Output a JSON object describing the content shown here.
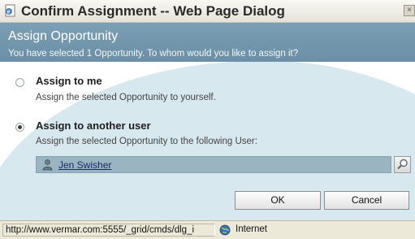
{
  "window": {
    "title": "Confirm Assignment -- Web Page Dialog",
    "close_glyph": "×"
  },
  "header": {
    "title": "Assign Opportunity",
    "subtitle": "You have selected 1 Opportunity. To whom would you like to assign it?"
  },
  "options": [
    {
      "label": "Assign to me",
      "description": "Assign the selected Opportunity to yourself.",
      "selected": false
    },
    {
      "label": "Assign to another user",
      "description": "Assign the selected Opportunity to the following User:",
      "selected": true
    }
  ],
  "lookup": {
    "value": "Jen Swisher",
    "icon": "user-icon",
    "button_icon": "magnifier-icon"
  },
  "buttons": {
    "ok": "OK",
    "cancel": "Cancel"
  },
  "statusbar": {
    "url": "http://www.vermar.com:5555/_grid/cmds/dlg_i",
    "zone": "Internet"
  },
  "colors": {
    "header": "#6f93a9",
    "lookup_bg": "#9ab4c2",
    "swoosh": "#d8e8ef"
  }
}
